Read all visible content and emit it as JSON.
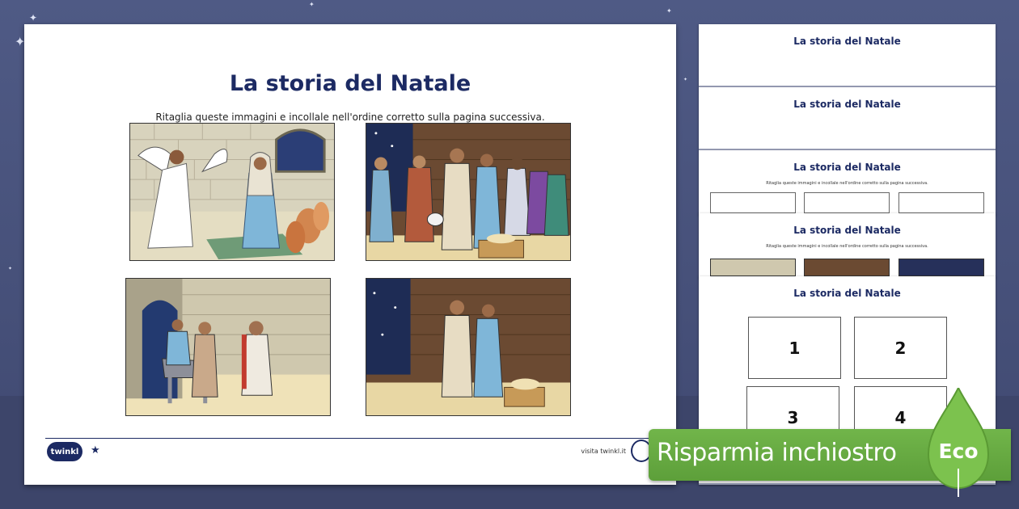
{
  "worksheet": {
    "title": "La storia del Natale",
    "instruction": "Ritaglia queste immagini e incollale nell'ordine corretto sulla pagina successiva.",
    "scenes": [
      {
        "icon": "annunciation-picture"
      },
      {
        "icon": "nativity-visitors-picture"
      },
      {
        "icon": "journey-to-bethlehem-picture"
      },
      {
        "icon": "holy-family-manger-picture"
      }
    ],
    "footer": {
      "logo_text": "twinkl",
      "link_text": "visita twinkl.it"
    }
  },
  "thumbnails": [
    {
      "title": "La storia del Natale"
    },
    {
      "title": "La storia del Natale"
    },
    {
      "title": "La storia del Natale",
      "subtitle": "Ritaglia queste immagini e incollale nell'ordine corretto sulla pagina successiva."
    },
    {
      "title": "La storia del Natale",
      "subtitle": "Ritaglia queste immagini e incollale nell'ordine corretto sulla pagina successiva."
    },
    {
      "title": "La storia del Natale",
      "numbers": [
        "1",
        "2",
        "3",
        "4"
      ]
    }
  ],
  "eco_banner": {
    "text": "Risparmia inchiostro",
    "badge": "Eco",
    "color": "#6aad45"
  },
  "colors": {
    "background": "#4a5480",
    "title": "#1c2a63"
  }
}
